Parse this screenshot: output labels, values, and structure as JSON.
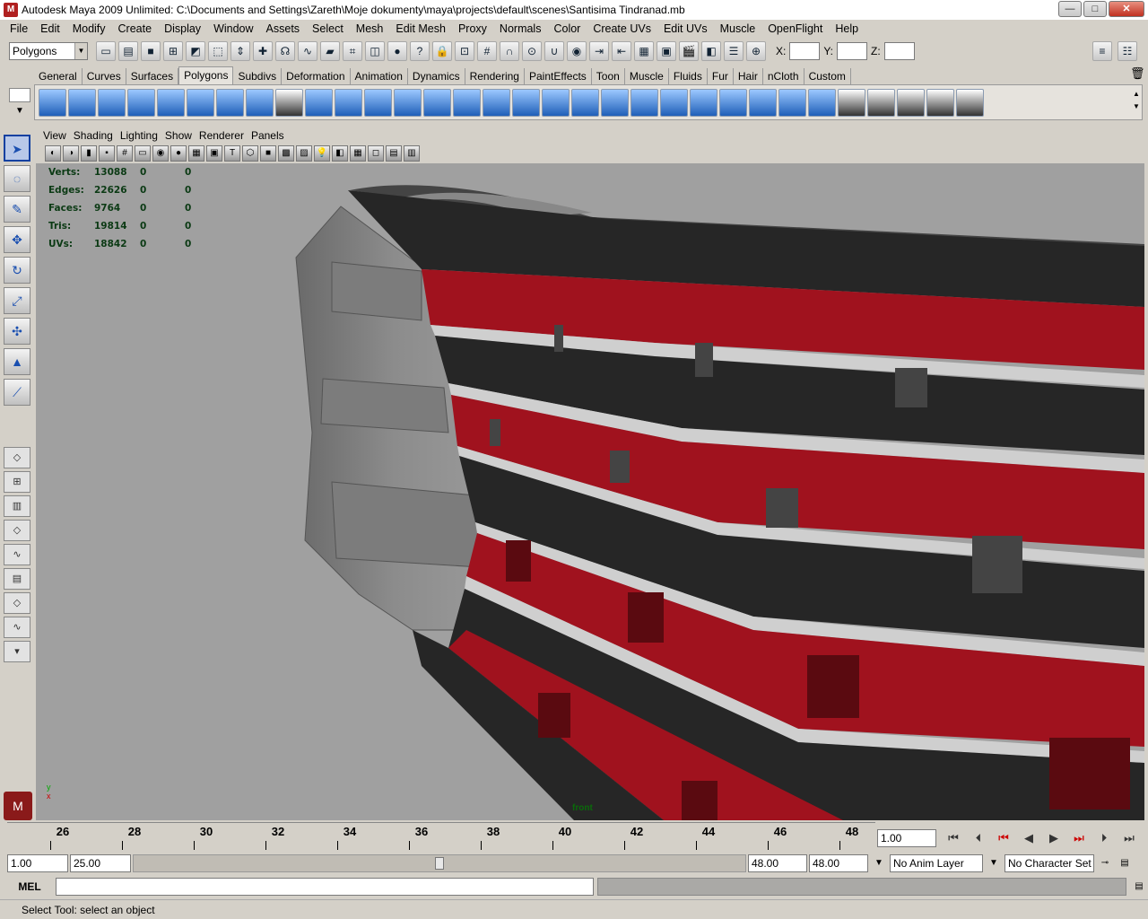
{
  "window": {
    "title": "Autodesk Maya 2009 Unlimited: C:\\Documents and Settings\\Zareth\\Moje dokumenty\\maya\\projects\\default\\scenes\\Santisima Tindranad.mb",
    "minimize": "—",
    "maximize": "□",
    "close": "✕"
  },
  "menu": [
    "File",
    "Edit",
    "Modify",
    "Create",
    "Display",
    "Window",
    "Assets",
    "Select",
    "Mesh",
    "Edit Mesh",
    "Proxy",
    "Normals",
    "Color",
    "Create UVs",
    "Edit UVs",
    "Muscle",
    "OpenFlight",
    "Help"
  ],
  "statusline": {
    "mode": "Polygons",
    "x_label": "X:",
    "y_label": "Y:",
    "z_label": "Z:"
  },
  "shelf_tabs": [
    "General",
    "Curves",
    "Surfaces",
    "Polygons",
    "Subdivs",
    "Deformation",
    "Animation",
    "Dynamics",
    "Rendering",
    "PaintEffects",
    "Toon",
    "Muscle",
    "Fluids",
    "Fur",
    "Hair",
    "nCloth",
    "Custom"
  ],
  "active_shelf": "Polygons",
  "panel_menu": [
    "View",
    "Shading",
    "Lighting",
    "Show",
    "Renderer",
    "Panels"
  ],
  "hud": {
    "rows": [
      {
        "label": "Verts:",
        "v1": "13088",
        "v2": "0",
        "v3": "0"
      },
      {
        "label": "Edges:",
        "v1": "22626",
        "v2": "0",
        "v3": "0"
      },
      {
        "label": "Faces:",
        "v1": "9764",
        "v2": "0",
        "v3": "0"
      },
      {
        "label": "Tris:",
        "v1": "19814",
        "v2": "0",
        "v3": "0"
      },
      {
        "label": "UVs:",
        "v1": "18842",
        "v2": "0",
        "v3": "0"
      }
    ]
  },
  "viewport": {
    "camera_label": "front",
    "axis_y": "y",
    "axis_x": "x"
  },
  "timeline": {
    "ticks": [
      "26",
      "28",
      "30",
      "32",
      "34",
      "36",
      "38",
      "40",
      "42",
      "44",
      "46",
      "48"
    ],
    "current_time": "1.00"
  },
  "range": {
    "start": "1.00",
    "inner_start": "25.00",
    "inner_end": "48.00",
    "end": "48.00",
    "anim_layer": "No Anim Layer",
    "char_set": "No Character Set"
  },
  "command": {
    "lang": "MEL"
  },
  "help_line": "Select Tool: select an object"
}
